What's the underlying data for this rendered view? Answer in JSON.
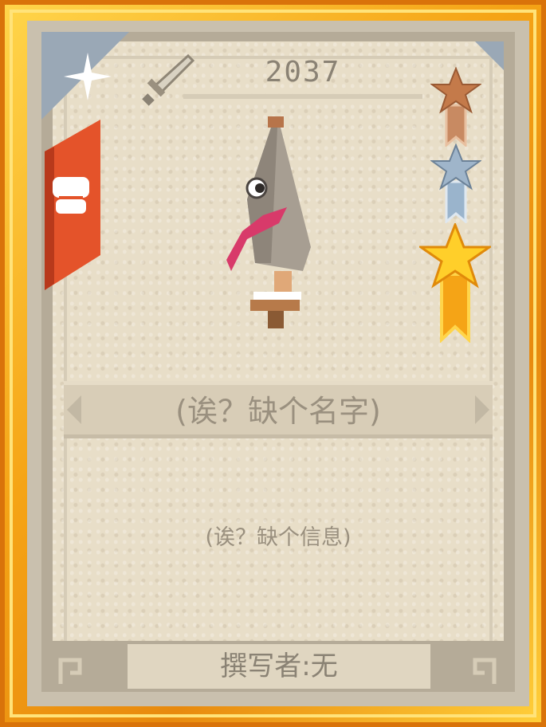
{
  "card": {
    "number": "2037",
    "name": "(诶？缺个名字)",
    "description": "(诶？缺个信息)",
    "author": "撰写者:无"
  },
  "icons": {
    "corner": "sparkle-icon",
    "type": "sword-icon",
    "ribbon": "fist-icon",
    "medals": [
      "bronze-star-medal-icon",
      "silver-star-medal-icon",
      "gold-star-medal-icon"
    ],
    "art": "fish-creature-sprite"
  },
  "colors": {
    "frame_gold": "#f5a416",
    "parchment": "#e8dec8",
    "ribbon_red": "#e4532a",
    "corner_blue": "#9aa8b6",
    "text": "#9a907f"
  }
}
